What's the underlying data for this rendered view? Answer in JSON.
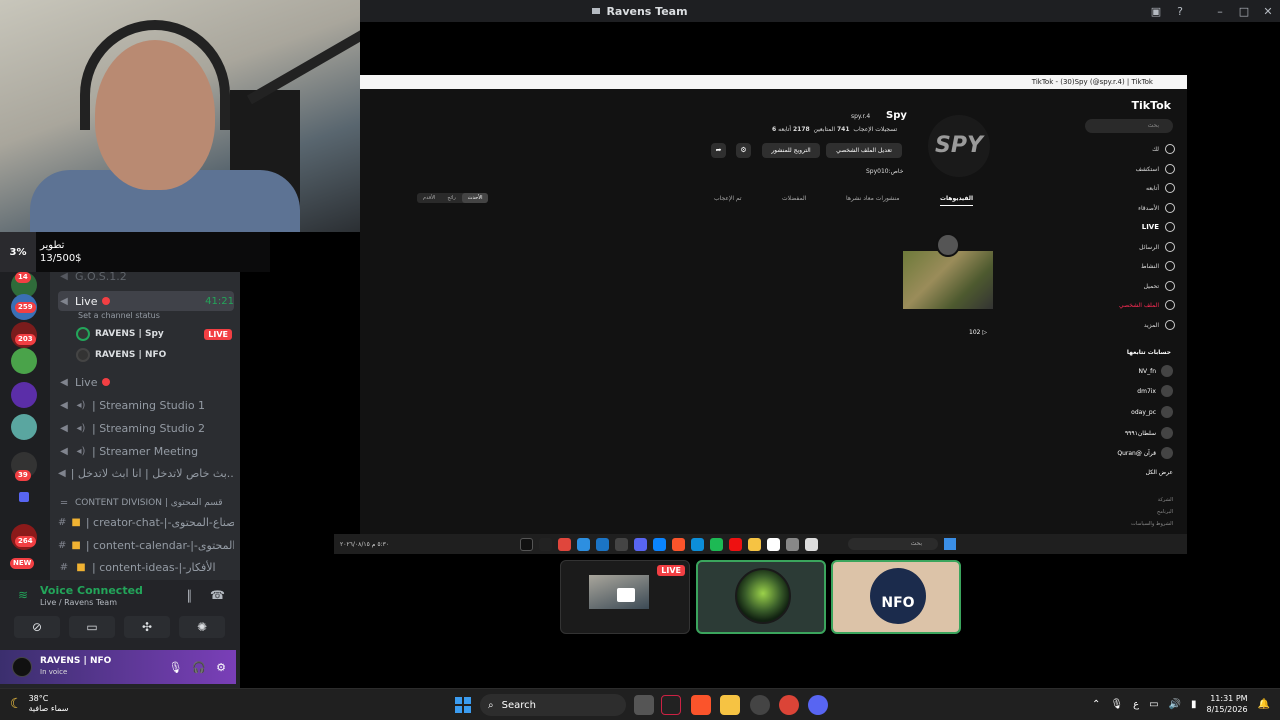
{
  "window": {
    "title": "Ravens Team"
  },
  "donation": {
    "percent": "3%",
    "label": "تطوير",
    "amount": "13/500$"
  },
  "servers": {
    "badges": [
      "14",
      "259",
      "203",
      "39",
      "264",
      "NEW"
    ]
  },
  "channels": {
    "prev_channel": "G.O.S.1.2",
    "live_active": {
      "label": "Live",
      "time": "41:21",
      "status": "Set a channel status"
    },
    "members": [
      {
        "name": "RAVENS | Spy",
        "live": "LIVE"
      },
      {
        "name": "RAVENS | NFO"
      }
    ],
    "voice_channels": [
      {
        "label": "Live"
      },
      {
        "label": "| Streaming Studio 1"
      },
      {
        "label": "| Streaming Studio 2"
      },
      {
        "label": "| Streamer Meeting"
      },
      {
        "label": "| بث خاص لاتدخل | انا ابث لاتدخل..."
      }
    ],
    "category": "CONTENT DIVISION | قسم المحتوى",
    "text_channels": [
      {
        "label": "| creator-chat-|-صناع-المحتوى"
      },
      {
        "label": "| content-calendar-|-جدول-المحتوى"
      },
      {
        "label": "| content-ideas-|-الأفكار"
      }
    ]
  },
  "voice_panel": {
    "status": "Voice Connected",
    "location": "Live / Ravens Team",
    "user_name": "RAVENS | NFO",
    "user_status": "In voice"
  },
  "tiktok": {
    "window_title": "TikTok - (30)Spy (@spy.r.4) | TikTok",
    "logo": "TikTok",
    "search_placeholder": "بحث",
    "nav": [
      "لك",
      "استكشف",
      "أتابعه",
      "الأصدقاء",
      "LIVE",
      "الرسائل",
      "النشاط",
      "تحميل",
      "الملف الشخصي",
      "المزيد"
    ],
    "following_title": "حسابات تتابعها",
    "following": [
      {
        "name": "NV_fn",
        "handle": "nv_fn"
      },
      {
        "name": "dm7ix",
        "handle": "dm7ix"
      },
      {
        "name": "oday_pc",
        "handle": "oday_pc"
      },
      {
        "name": "سلطان٩٩٩١",
        "handle": "st622_1"
      },
      {
        "name": "Quran@ قرآن",
        "handle": "a_t_t_a_d"
      }
    ],
    "show_all": "عرض الكل",
    "footer": [
      "الشركة",
      "البرنامج",
      "الشروط والسياسات"
    ],
    "profile": {
      "avatar_text": "SPY",
      "name": "Spy",
      "username": "spy.r.4",
      "following_count": "2178",
      "following_label": "أتابعه",
      "followers_count": "741",
      "followers_label": "المتابعين",
      "likes_count": "6",
      "likes_label": "تسجيلات الإعجاب",
      "bio": "Spy010:خاص",
      "edit_button": "تعديل الملف الشخصي",
      "promote_button": "الترويج للمنشور"
    },
    "tabs": [
      "الفيديوهات",
      "منشورات معاد نشرها",
      "المفضلات",
      "تم الإعجاب"
    ],
    "sort": [
      "الأحدث",
      "رائج",
      "الأقدم"
    ],
    "video_views": "102"
  },
  "stream_taskbar": {
    "left_text": "٥:٣٠ م  ٢٠٢٦/٠٨/١٥",
    "search": "بحث"
  },
  "tiles": {
    "live_tag": "LIVE",
    "nfo_text": "NFO"
  },
  "taskbar": {
    "temperature": "38°C",
    "weather": "سماء صافية",
    "search": "Search",
    "time": "11:31 PM",
    "date": "8/15/2026",
    "lang": "ع"
  }
}
